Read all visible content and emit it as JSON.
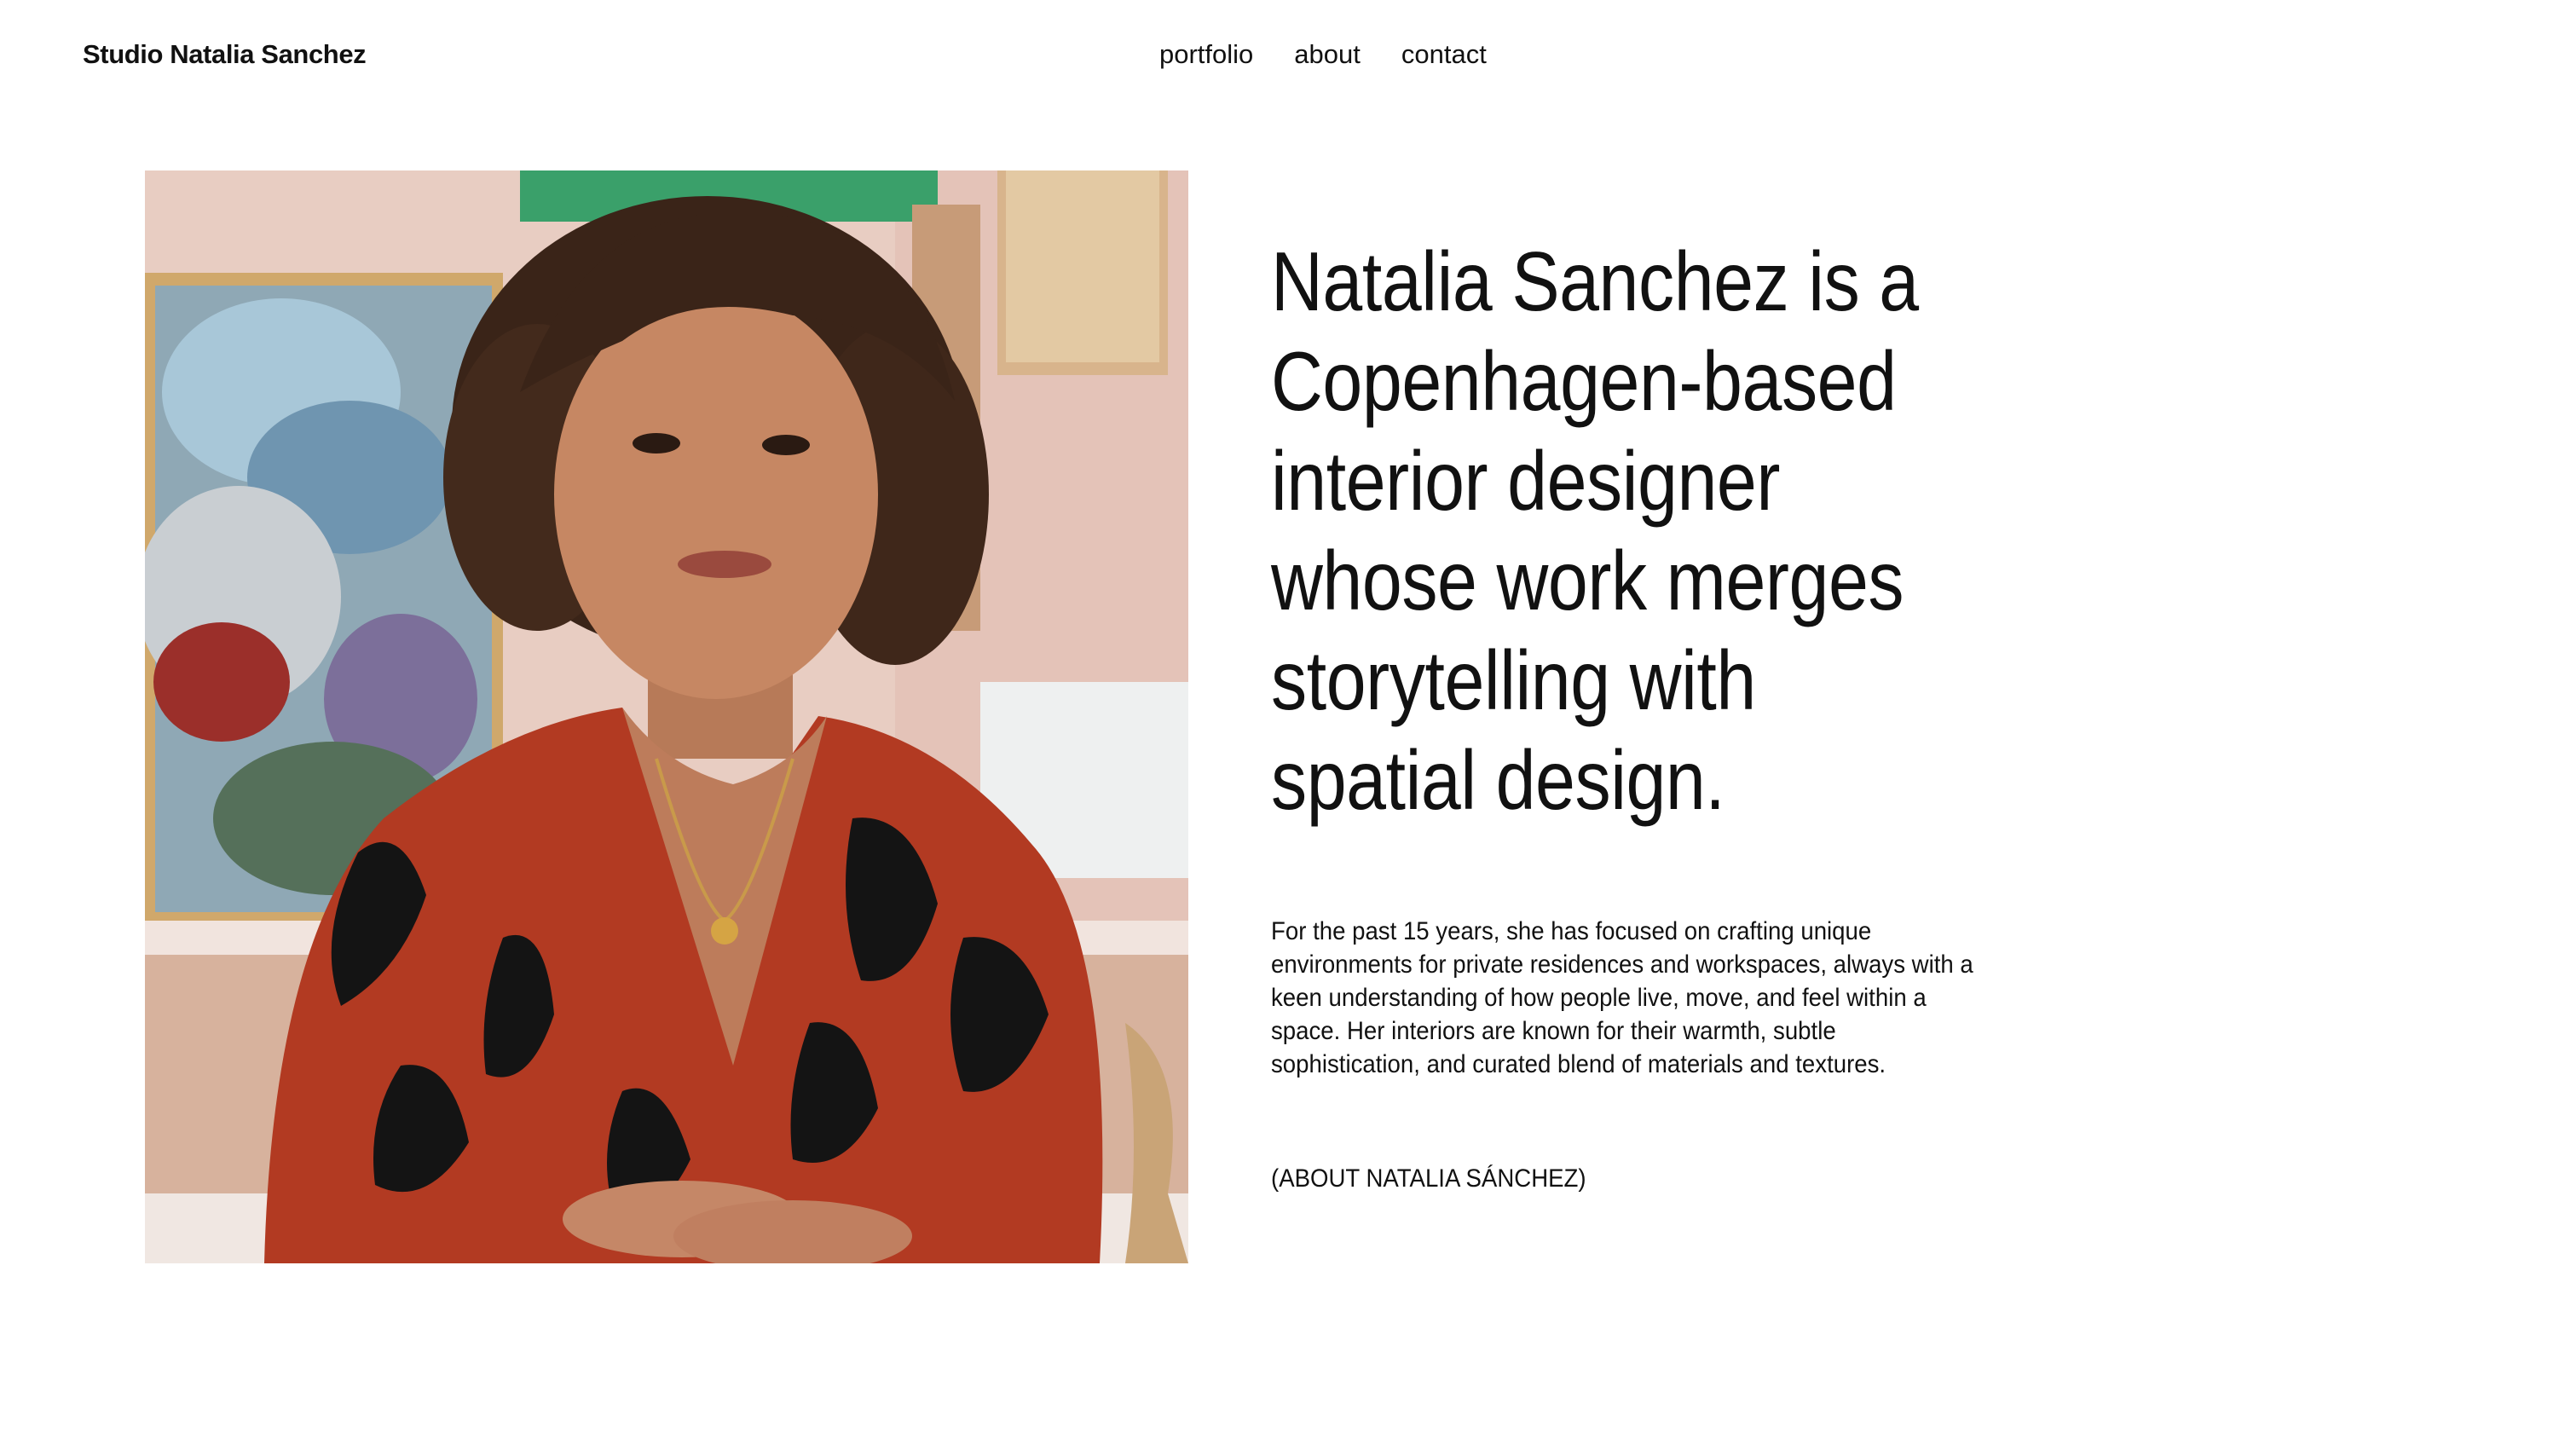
{
  "header": {
    "brand": "Studio Natalia Sanchez",
    "nav": {
      "portfolio": "portfolio",
      "about": "about",
      "contact": "contact"
    }
  },
  "hero": {
    "headline": "Natalia Sanchez is a Copenhagen-based interior designer whose work merges storytelling with spatial design.",
    "body": "For the past 15 years, she has focused on crafting unique environments for private residences and workspaces, always with a keen understanding of how people live, move, and feel within a space. Her interiors are known for their warmth, subtle sophistication, and curated blend of materials and textures.",
    "about_link": "(ABOUT NATALIA SÁNCHEZ)"
  },
  "colors": {
    "background": "#ffffff",
    "text": "#111111",
    "blouse": "#b23a22",
    "wall": "#e9cfc4"
  }
}
